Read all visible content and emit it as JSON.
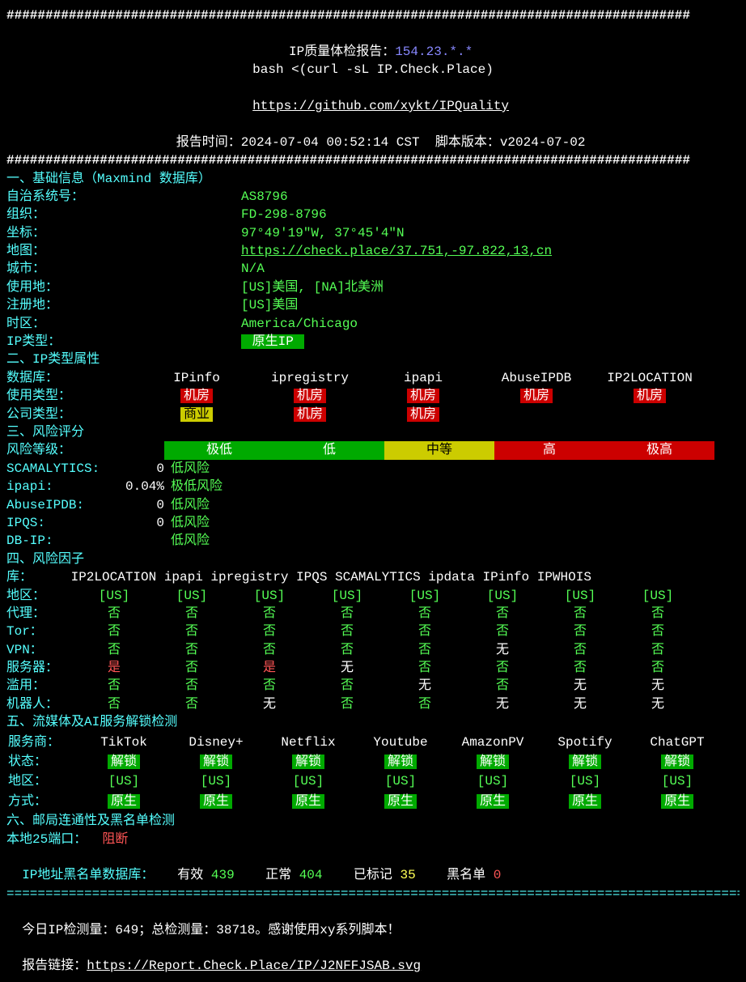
{
  "header": {
    "title_prefix": "IP质量体检报告：",
    "ip": "154.23.*.*",
    "bash_cmd": "bash <(curl -sL IP.Check.Place)",
    "github_url": "https://github.com/xykt/IPQuality",
    "report_time_label": "报告时间：",
    "report_time": "2024-07-04 00:52:14 CST",
    "script_ver_label": "脚本版本：",
    "script_ver": "v2024-07-02"
  },
  "s1": {
    "title": "一、基础信息（Maxmind 数据库）",
    "asn_label": "自治系统号：",
    "asn": "AS8796",
    "org_label": "组织：",
    "org": "FD-298-8796",
    "coord_label": "坐标：",
    "coord": "97°49′19″W, 37°45′4″N",
    "map_label": "地图：",
    "map_url": "https://check.place/37.751,-97.822,13,cn",
    "city_label": "城市：",
    "city": "N/A",
    "use_label": "使用地：",
    "use": "[US]美国, [NA]北美洲",
    "reg_label": "注册地：",
    "reg": "[US]美国",
    "tz_label": "时区：",
    "tz": "America/Chicago",
    "iptype_label": "IP类型：",
    "iptype": " 原生IP "
  },
  "s2": {
    "title": "二、IP类型属性",
    "db_label": "数据库：",
    "dbs": [
      "IPinfo",
      "ipregistry",
      "ipapi",
      "AbuseIPDB",
      "IP2LOCATION"
    ],
    "usage_label": "使用类型：",
    "usage": [
      {
        "t": "机房",
        "c": "r"
      },
      {
        "t": "机房",
        "c": "r"
      },
      {
        "t": "机房",
        "c": "r"
      },
      {
        "t": "机房",
        "c": "r"
      },
      {
        "t": "机房",
        "c": "r"
      }
    ],
    "company_label": "公司类型：",
    "company": [
      {
        "t": "商业",
        "c": "y"
      },
      {
        "t": "机房",
        "c": "r"
      },
      {
        "t": "机房",
        "c": "r"
      },
      {
        "t": "",
        "c": ""
      },
      {
        "t": "",
        "c": ""
      }
    ]
  },
  "s3": {
    "title": "三、风险评分",
    "risk_level_label": "风险等级：",
    "risk_levels": [
      "极低",
      "低",
      "中等",
      "高",
      "极高"
    ],
    "rows": [
      {
        "name": "SCAMALYTICS:",
        "val": "0",
        "res": "低风险"
      },
      {
        "name": "ipapi:",
        "val": "0.04%",
        "res": "极低风险"
      },
      {
        "name": "AbuseIPDB:",
        "val": "0",
        "res": "低风险"
      },
      {
        "name": "IPQS:",
        "val": "0",
        "res": "低风险"
      },
      {
        "name": "DB-IP:",
        "val": "",
        "res": "低风险"
      }
    ]
  },
  "s4": {
    "title": "四、风险因子",
    "src_label": "库：",
    "sources": [
      "IP2LOCATION",
      "ipapi",
      "ipregistry",
      "IPQS",
      "SCAMALYTICS",
      "ipdata",
      "IPinfo",
      "IPWHOIS"
    ],
    "rows": [
      {
        "label": "地区：",
        "vals": [
          {
            "t": "[US]",
            "c": "g"
          },
          {
            "t": "[US]",
            "c": "g"
          },
          {
            "t": "[US]",
            "c": "g"
          },
          {
            "t": "[US]",
            "c": "g"
          },
          {
            "t": "[US]",
            "c": "g"
          },
          {
            "t": "[US]",
            "c": "g"
          },
          {
            "t": "[US]",
            "c": "g"
          },
          {
            "t": "[US]",
            "c": "g"
          }
        ]
      },
      {
        "label": "代理：",
        "vals": [
          {
            "t": "否",
            "c": "g"
          },
          {
            "t": "否",
            "c": "g"
          },
          {
            "t": "否",
            "c": "g"
          },
          {
            "t": "否",
            "c": "g"
          },
          {
            "t": "否",
            "c": "g"
          },
          {
            "t": "否",
            "c": "g"
          },
          {
            "t": "否",
            "c": "g"
          },
          {
            "t": "否",
            "c": "g"
          }
        ]
      },
      {
        "label": "Tor：",
        "vals": [
          {
            "t": "否",
            "c": "g"
          },
          {
            "t": "否",
            "c": "g"
          },
          {
            "t": "否",
            "c": "g"
          },
          {
            "t": "否",
            "c": "g"
          },
          {
            "t": "否",
            "c": "g"
          },
          {
            "t": "否",
            "c": "g"
          },
          {
            "t": "否",
            "c": "g"
          },
          {
            "t": "否",
            "c": "g"
          }
        ]
      },
      {
        "label": "VPN：",
        "vals": [
          {
            "t": "否",
            "c": "g"
          },
          {
            "t": "否",
            "c": "g"
          },
          {
            "t": "否",
            "c": "g"
          },
          {
            "t": "否",
            "c": "g"
          },
          {
            "t": "否",
            "c": "g"
          },
          {
            "t": "无",
            "c": "w"
          },
          {
            "t": "否",
            "c": "g"
          },
          {
            "t": "否",
            "c": "g"
          }
        ]
      },
      {
        "label": "服务器：",
        "vals": [
          {
            "t": "是",
            "c": "r"
          },
          {
            "t": "否",
            "c": "g"
          },
          {
            "t": "是",
            "c": "r"
          },
          {
            "t": "无",
            "c": "w"
          },
          {
            "t": "否",
            "c": "g"
          },
          {
            "t": "否",
            "c": "g"
          },
          {
            "t": "否",
            "c": "g"
          },
          {
            "t": "否",
            "c": "g"
          }
        ]
      },
      {
        "label": "滥用：",
        "vals": [
          {
            "t": "否",
            "c": "g"
          },
          {
            "t": "否",
            "c": "g"
          },
          {
            "t": "否",
            "c": "g"
          },
          {
            "t": "否",
            "c": "g"
          },
          {
            "t": "无",
            "c": "w"
          },
          {
            "t": "否",
            "c": "g"
          },
          {
            "t": "无",
            "c": "w"
          },
          {
            "t": "无",
            "c": "w"
          }
        ]
      },
      {
        "label": "机器人：",
        "vals": [
          {
            "t": "否",
            "c": "g"
          },
          {
            "t": "否",
            "c": "g"
          },
          {
            "t": "无",
            "c": "w"
          },
          {
            "t": "否",
            "c": "g"
          },
          {
            "t": "否",
            "c": "g"
          },
          {
            "t": "无",
            "c": "w"
          },
          {
            "t": "无",
            "c": "w"
          },
          {
            "t": "无",
            "c": "w"
          }
        ]
      }
    ]
  },
  "s5": {
    "title": "五、流媒体及AI服务解锁检测",
    "prov_label": "服务商：",
    "providers": [
      "TikTok",
      "Disney+",
      "Netflix",
      "Youtube",
      "AmazonPV",
      "Spotify",
      "ChatGPT"
    ],
    "status_label": "状态：",
    "status": [
      " 解锁 ",
      " 解锁 ",
      " 解锁 ",
      " 解锁 ",
      " 解锁 ",
      " 解锁 ",
      " 解锁 "
    ],
    "region_label": "地区：",
    "region": [
      "[US]",
      "[US]",
      "[US]",
      "[US]",
      "[US]",
      "[US]",
      "[US]"
    ],
    "method_label": "方式：",
    "method": [
      " 原生 ",
      " 原生 ",
      " 原生 ",
      " 原生 ",
      " 原生 ",
      " 原生 ",
      " 原生 "
    ]
  },
  "s6": {
    "title": "六、邮局连通性及黑名单检测",
    "port_label": "本地25端口：",
    "port_val": "阻断",
    "bl_label": "IP地址黑名单数据库：",
    "valid_label": "有效",
    "valid_n": "439",
    "ok_label": "正常",
    "ok_n": "404",
    "marked_label": "已标记",
    "marked_n": "35",
    "bl2_label": "黑名单",
    "bl2_n": "0"
  },
  "footer": {
    "stats_prefix": "今日IP检测量：",
    "today": "649",
    "total_prefix": "；总检测量：",
    "total": "38718",
    "thanks": "。感谢使用xy系列脚本！",
    "link_label": "报告链接：",
    "link_url": "https://Report.Check.Place/IP/J2NFFJSAB.svg"
  }
}
